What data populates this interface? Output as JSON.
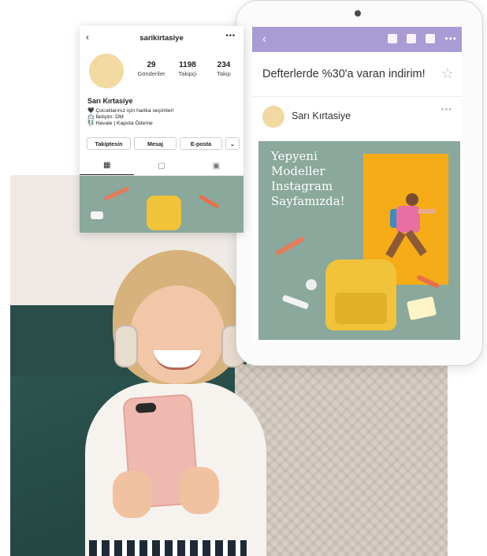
{
  "instagram": {
    "back_icon": "chevron-left-icon",
    "username": "sarikirtasiye",
    "more_icon": "ellipsis-icon",
    "stats": [
      {
        "value": "29",
        "label": "Gönderiler"
      },
      {
        "value": "1198",
        "label": "Takipçi"
      },
      {
        "value": "234",
        "label": "Takip"
      }
    ],
    "display_name": "Sarı Kırtasiye",
    "bio": [
      "🖤 Çocuklarınız için harika seçimler!",
      "📇 İletişim: DM",
      "💱 Havale | Kapıda Ödeme"
    ],
    "buttons": {
      "follow": "Takiptesin",
      "message": "Mesaj",
      "email": "E-posta",
      "more_icon": "chevron-down-icon"
    },
    "tabs": [
      "grid-icon",
      "igtv-icon",
      "tagged-icon"
    ]
  },
  "email": {
    "back_icon": "chevron-left-icon",
    "toolbar_icons": [
      "archive-icon",
      "trash-icon",
      "mail-icon",
      "ellipsis-icon"
    ],
    "subject": "Defterlerde %30'a varan indirim!",
    "star_icon": "star-outline-icon",
    "sender": "Sarı Kırtasiye",
    "promo_text": [
      "Yepyeni",
      "Modeller",
      "Instagram",
      "Sayfamızda!"
    ]
  },
  "colors": {
    "mail_header": "#a99bd3",
    "promo_bg": "#8aa89b",
    "promo_photo": "#f5ac16",
    "avatar": "#f3d9a2"
  }
}
